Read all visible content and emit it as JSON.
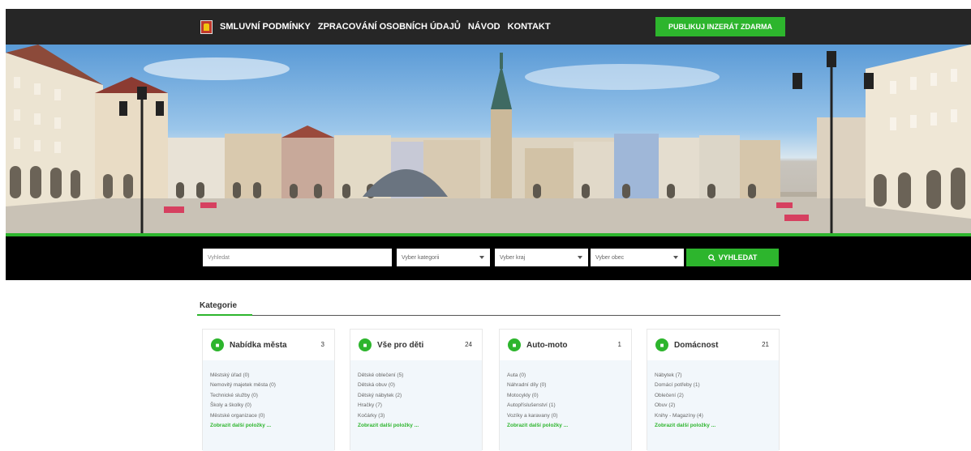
{
  "nav": {
    "items": [
      "SMLUVNÍ PODMÍNKY",
      "ZPRACOVÁNÍ OSOBNÍCH ÚDAJŮ",
      "NÁVOD",
      "KONTAKT"
    ],
    "publish_label": "PUBLIKUJ INZERÁT ZDARMA"
  },
  "search": {
    "input_placeholder": "Vyhledat",
    "category_placeholder": "Vyber kategorii",
    "region_placeholder": "Vyber kraj",
    "municipality_placeholder": "Vyber obec",
    "button_label": "VYHLEDAT"
  },
  "categories": {
    "title": "Kategorie",
    "cards": [
      {
        "name": "Nabídka města",
        "count": "3",
        "items": [
          "Městský úřad (0)",
          "Nemovitý majetek města (0)",
          "Technické služby (0)",
          "Školy a školky (0)",
          "Městské organizace (0)"
        ],
        "more": "Zobrazit další položky ..."
      },
      {
        "name": "Vše pro děti",
        "count": "24",
        "items": [
          "Dětské oblečení (5)",
          "Dětská obuv (0)",
          "Dětský nábytek (2)",
          "Hračky (7)",
          "Kočárky (3)"
        ],
        "more": "Zobrazit další položky ..."
      },
      {
        "name": "Auto-moto",
        "count": "1",
        "items": [
          "Auta (0)",
          "Náhradní díly (0)",
          "Motocykly (0)",
          "Autopříslušenství (1)",
          "Vozíky a karavany (0)"
        ],
        "more": "Zobrazit další položky ..."
      },
      {
        "name": "Domácnost",
        "count": "21",
        "items": [
          "Nábytek (7)",
          "Domácí potřeby (1)",
          "Oblečení (2)",
          "Obuv (2)",
          "Knihy - Magazíny (4)"
        ],
        "more": "Zobrazit další položky ..."
      }
    ]
  },
  "colors": {
    "accent": "#2db52d",
    "topbar": "#262626",
    "searchbar": "#000000"
  },
  "icons": {
    "logo": "city-coat-of-arms-icon",
    "search": "search-icon",
    "card": "cart-icon"
  }
}
